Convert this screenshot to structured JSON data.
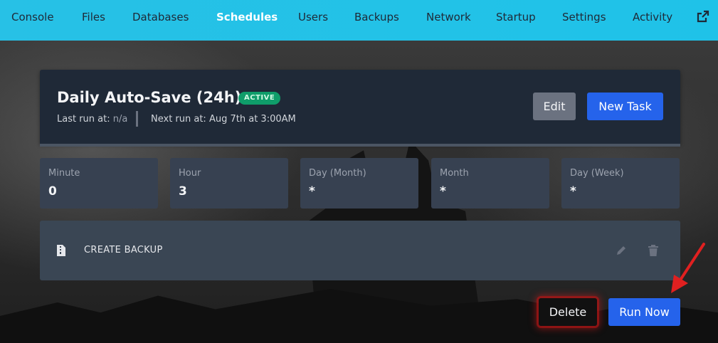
{
  "nav": {
    "items": [
      {
        "label": "Console"
      },
      {
        "label": "Files"
      },
      {
        "label": "Databases"
      },
      {
        "label": "Schedules"
      },
      {
        "label": "Users"
      },
      {
        "label": "Backups"
      },
      {
        "label": "Network"
      },
      {
        "label": "Startup"
      },
      {
        "label": "Settings"
      },
      {
        "label": "Activity"
      }
    ],
    "external_icon": "external-link-icon"
  },
  "schedule": {
    "title": "Daily Auto-Save (24h)",
    "status": "ACTIVE",
    "status_color": "#0f9d6a",
    "last_run_label": "Last run at:",
    "last_run_value": "n/a",
    "next_run_label": "Next run at:",
    "next_run_value": "Aug 7th at 3:00AM",
    "edit_label": "Edit",
    "new_task_label": "New Task"
  },
  "cron": [
    {
      "label": "Minute",
      "value": "0"
    },
    {
      "label": "Hour",
      "value": "3"
    },
    {
      "label": "Day (Month)",
      "value": "*"
    },
    {
      "label": "Month",
      "value": "*"
    },
    {
      "label": "Day (Week)",
      "value": "*"
    }
  ],
  "task": {
    "label": "CREATE BACKUP",
    "icon": "file-archive-icon",
    "edit_icon": "pencil-icon",
    "delete_icon": "trash-icon"
  },
  "actions": {
    "delete_label": "Delete",
    "run_now_label": "Run Now"
  },
  "colors": {
    "accent": "#2563eb",
    "nav_bg": "#27c1e6",
    "annotation_arrow": "#e02020"
  }
}
